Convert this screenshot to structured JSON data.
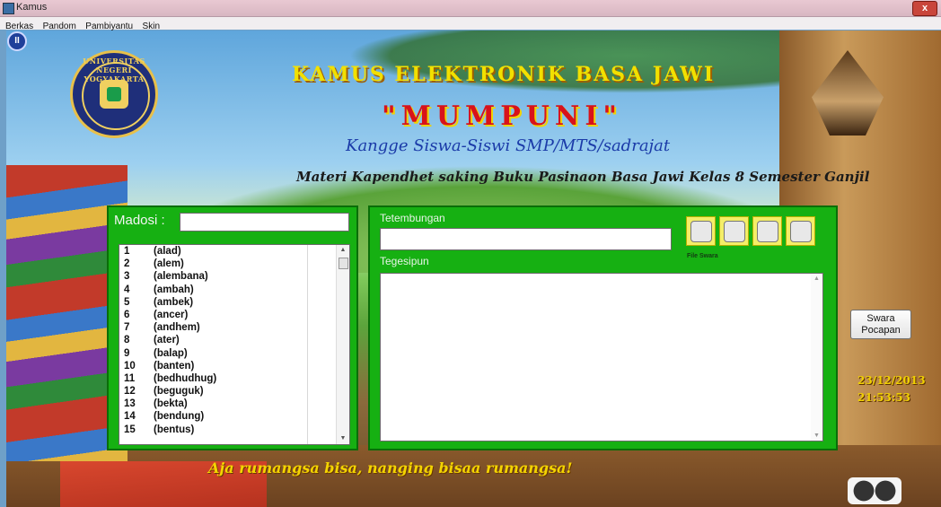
{
  "window": {
    "title": "Kamus",
    "close_label": "x"
  },
  "menu": [
    "Berkas",
    "Pandom",
    "Pambiyantu",
    "Skin"
  ],
  "header": {
    "logo_text": "UNIVERSITAS NEGERI YOGYAKARTA",
    "title": "KAMUS ELEKTRONIK BASA JAWI",
    "subtitle": "\"MUMPUNI\"",
    "audience": "Kangge Siswa-Siswi SMP/MTS/sadrajat",
    "material": "Materi Kapendhet saking Buku Pasinaon Basa Jawi Kelas 8 Semester Ganjil"
  },
  "search": {
    "label": "Madosi :",
    "value": ""
  },
  "word_list": [
    {
      "no": "1",
      "word": "(alad)"
    },
    {
      "no": "2",
      "word": "(alem)"
    },
    {
      "no": "3",
      "word": "(alembana)"
    },
    {
      "no": "4",
      "word": "(ambah)"
    },
    {
      "no": "5",
      "word": "(ambek)"
    },
    {
      "no": "6",
      "word": "(ancer)"
    },
    {
      "no": "7",
      "word": "(andhem)"
    },
    {
      "no": "8",
      "word": "(ater)"
    },
    {
      "no": "9",
      "word": "(balap)"
    },
    {
      "no": "10",
      "word": "(banten)"
    },
    {
      "no": "11",
      "word": "(bedhudhug)"
    },
    {
      "no": "12",
      "word": "(beguguk)"
    },
    {
      "no": "13",
      "word": "(bekta)"
    },
    {
      "no": "14",
      "word": "(bendung)"
    },
    {
      "no": "15",
      "word": "(bentus)"
    }
  ],
  "detail": {
    "word_label": "Tetembungan",
    "word_value": "",
    "meaning_label": "Tegesipun",
    "meaning_value": "",
    "file_swara_label": "File Swara",
    "icons": [
      "new-file-icon",
      "save-icon",
      "edit-icon",
      "delete-icon"
    ]
  },
  "swara_button": {
    "line1": "Swara",
    "line2": "Pocapan"
  },
  "clock": {
    "date": "23/12/2013",
    "time": "21:53:53"
  },
  "motto": "Aja rumangsa bisa, nanging bisaa rumangsa!",
  "colors": {
    "panel": "#16b012",
    "title_yellow": "#f2e000",
    "subtitle_red": "#d8121a"
  }
}
